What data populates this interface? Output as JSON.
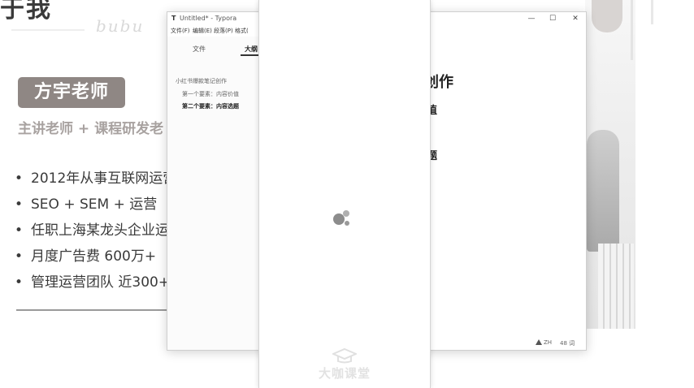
{
  "slide": {
    "title": "于我",
    "signature": "bubu",
    "name_badge": "方宇老师",
    "role": "主讲老师 + 课程研发老",
    "bullets": [
      "2012年从事互联网运营",
      "SEO + SEM + 运营",
      "任职上海某龙头企业运",
      "月度广告费 600万+",
      "管理运营团队 近300+"
    ],
    "bullet_marker": "•"
  },
  "window": {
    "app_icon": "T",
    "title": "Untitled* - Typora",
    "controls": {
      "minimize": "—",
      "maximize": "☐",
      "close": "✕"
    },
    "menu": [
      "文件(F)",
      "编辑(E)",
      "段落(P)",
      "格式("
    ],
    "sidebar": {
      "tabs": [
        {
          "label": "文件",
          "active": false
        },
        {
          "label": "大纲",
          "active": true
        }
      ],
      "outline": [
        {
          "label": "小红书爆款笔记创作",
          "level": 1,
          "strong": false
        },
        {
          "label": "第一个要素：内容价值",
          "level": 2,
          "strong": false
        },
        {
          "label": "第二个要素：内容选题",
          "level": 2,
          "strong": true
        }
      ]
    },
    "editor_fragments": {
      "heading_tail": "创作",
      "line2_tail": "值",
      "line3_tail": "题"
    },
    "status": {
      "lang": "ZH",
      "word_count": "48 词"
    }
  },
  "overlay": {
    "watermark": "大咖课堂"
  },
  "colors": {
    "badge": "#8f8784",
    "accent_text": "#a8a2a0",
    "spinner": "#8a8a8a"
  }
}
